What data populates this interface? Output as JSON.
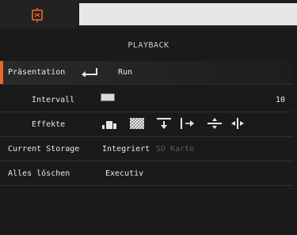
{
  "header": {
    "icon": "gear-frame-icon",
    "accent": "#e8672a"
  },
  "title": "PLAYBACK",
  "menu": {
    "presentation": {
      "label": "Präsentation",
      "value": "Run",
      "icon": "enter-icon"
    },
    "interval": {
      "label": "Intervall",
      "value": "10"
    },
    "effects": {
      "label": "Effekte",
      "icons": [
        "blocks-effect-icon",
        "dissolve-effect-icon",
        "wipe-down-icon",
        "wipe-right-icon",
        "split-vertical-icon",
        "split-horizontal-icon"
      ]
    },
    "storage": {
      "label": "Current Storage",
      "option_active": "Integriert",
      "option_inactive": "SD Karte"
    },
    "delete_all": {
      "label": "Alles löschen",
      "value": "Executiv"
    }
  }
}
